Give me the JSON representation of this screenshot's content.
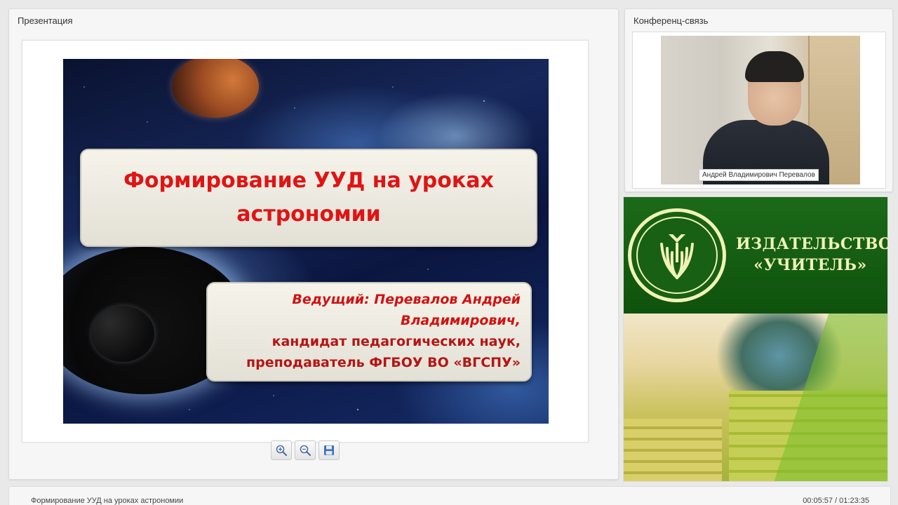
{
  "presentation_panel": {
    "title": "Презентация",
    "slide": {
      "title": "Формирование УУД на уроках астрономии",
      "author_line1": "Ведущий: Перевалов Андрей",
      "author_line2": "Владимирович,",
      "author_line3": "кандидат педагогических наук,",
      "author_line4": "преподаватель ФГБОУ ВО «ВГСПУ»"
    },
    "tools": [
      "zoom-in-icon",
      "zoom-out-icon",
      "save-icon"
    ]
  },
  "conference_panel": {
    "title": "Конференц-связь",
    "participant_name": "Андрей Владимирович Перевалов"
  },
  "publisher_banner": {
    "line1": "ИЗДАТЕЛЬСТВО",
    "line2": "«УЧИТЕЛЬ»"
  },
  "bottom_bar": {
    "title": "Формирование УУД на уроках астрономии",
    "time": "00:05:57 / 01:23:35"
  },
  "colors": {
    "slide_title": "#e01414",
    "banner_green": "#176014",
    "banner_text": "#f1f2b6"
  }
}
